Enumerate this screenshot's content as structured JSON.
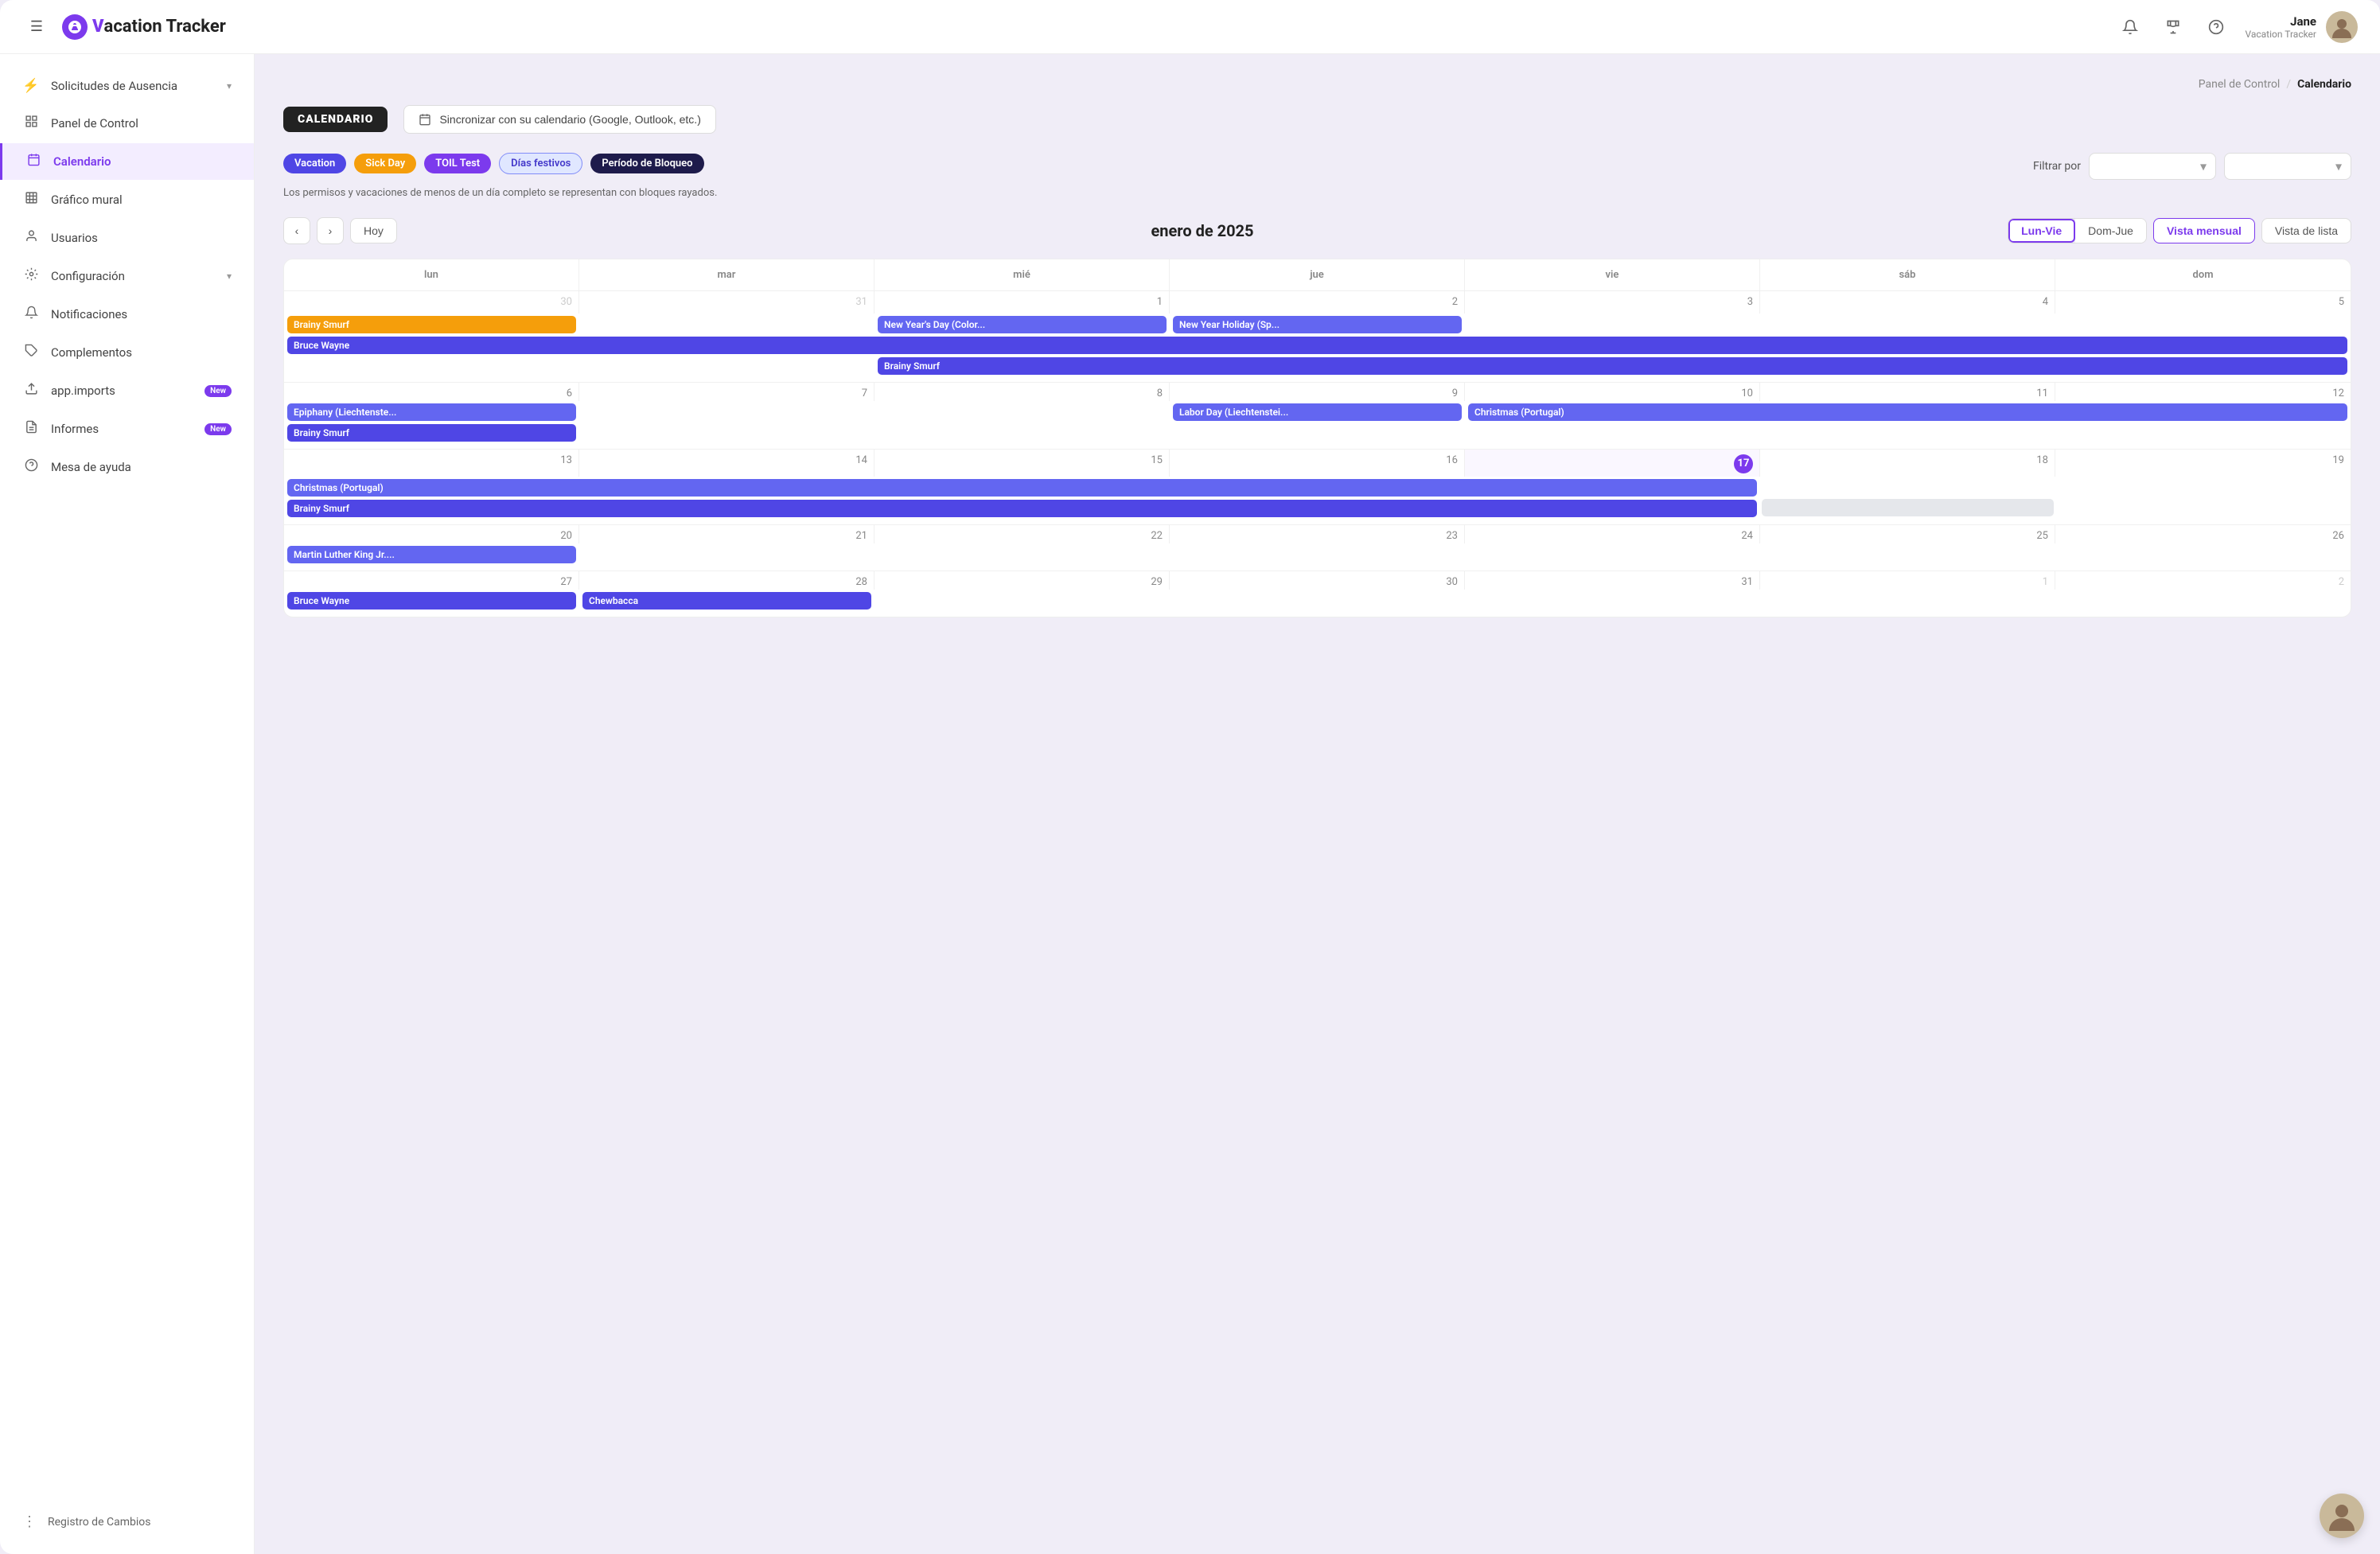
{
  "header": {
    "menu_icon": "☰",
    "logo_icon": "V",
    "logo_text": "acation Tracker",
    "logo_brand": "V",
    "icons": {
      "notification": "🔔",
      "trophy": "🏆",
      "help": "?"
    },
    "user": {
      "name": "Jane",
      "subtitle": "Vacation Tracker",
      "avatar": "👩"
    }
  },
  "sidebar": {
    "items": [
      {
        "id": "solicitudes",
        "label": "Solicitudes de Ausencia",
        "icon": "⚡",
        "has_chevron": true
      },
      {
        "id": "panel",
        "label": "Panel de Control",
        "icon": "◻"
      },
      {
        "id": "calendario",
        "label": "Calendario",
        "icon": "📅",
        "active": true
      },
      {
        "id": "grafico",
        "label": "Gráfico mural",
        "icon": "⊞"
      },
      {
        "id": "usuarios",
        "label": "Usuarios",
        "icon": "👤"
      },
      {
        "id": "configuracion",
        "label": "Configuración",
        "icon": "⚙",
        "has_chevron": true
      },
      {
        "id": "notificaciones",
        "label": "Notificaciones",
        "icon": "🔔"
      },
      {
        "id": "complementos",
        "label": "Complementos",
        "icon": "🧩"
      },
      {
        "id": "app-imports",
        "label": "app.imports",
        "icon": "📤",
        "badge": "New"
      },
      {
        "id": "informes",
        "label": "Informes",
        "icon": "📋",
        "badge": "New"
      },
      {
        "id": "mesa-ayuda",
        "label": "Mesa de ayuda",
        "icon": "?"
      }
    ],
    "footer": {
      "icon": "⋮",
      "label": "Registro de Cambios"
    }
  },
  "content": {
    "breadcrumb": {
      "parent": "Panel de Control",
      "separator": "/",
      "current": "Calendario"
    },
    "page_title": "CALENDARIO",
    "sync_button": "Sincronizar con su calendario (Google, Outlook, etc.)",
    "legend": {
      "chips": [
        {
          "label": "Vacation",
          "class": "legend-vacation"
        },
        {
          "label": "Sick Day",
          "class": "legend-sick"
        },
        {
          "label": "TOIL Test",
          "class": "legend-toil"
        },
        {
          "label": "Días festivos",
          "class": "legend-festivos"
        },
        {
          "label": "Período de Bloqueo",
          "class": "legend-bloqueo"
        }
      ],
      "note": "Los permisos y vacaciones de menos de un día completo se representan con bloques rayados."
    },
    "filter": {
      "label": "Filtrar por",
      "placeholder": ""
    },
    "calendar": {
      "month_title": "enero de 2025",
      "nav": {
        "prev": "‹",
        "next": "›",
        "today": "Hoy"
      },
      "view_days": [
        {
          "label": "Lun-Vie",
          "active": true
        },
        {
          "label": "Dom-Jue",
          "active": false
        }
      ],
      "view_modes": [
        {
          "label": "Vista mensual",
          "active": true
        },
        {
          "label": "Vista de lista",
          "active": false
        }
      ],
      "weekdays": [
        "lun",
        "mar",
        "mié",
        "jue",
        "vie",
        "sáb",
        "dom"
      ],
      "weeks": [
        {
          "days": [
            {
              "num": "30",
              "other": true
            },
            {
              "num": "31",
              "other": true
            },
            {
              "num": "1",
              "other": false
            },
            {
              "num": "2",
              "other": false
            },
            {
              "num": "3",
              "other": false
            },
            {
              "num": "4",
              "other": false
            },
            {
              "num": "5",
              "other": false
            }
          ],
          "events": [
            {
              "label": "Brainy Smurf",
              "type": "sick",
              "col_start": 1,
              "col_span": 1
            },
            {
              "label": "Bruce Wayne",
              "type": "vacation",
              "col_start": 1,
              "col_span": 7
            },
            {
              "label": "New Year's Day (Colom...",
              "type": "holiday",
              "col_start": 3,
              "col_span": 1
            },
            {
              "label": "New Year Holiday (Sp...",
              "type": "holiday",
              "col_start": 4,
              "col_span": 1
            },
            {
              "label": "Brainy Smurf",
              "type": "vacation",
              "col_start": 3,
              "col_span": 5
            }
          ]
        },
        {
          "days": [
            {
              "num": "6",
              "other": false
            },
            {
              "num": "7",
              "other": false
            },
            {
              "num": "8",
              "other": false
            },
            {
              "num": "9",
              "other": false
            },
            {
              "num": "10",
              "other": false
            },
            {
              "num": "11",
              "other": false
            },
            {
              "num": "12",
              "other": false
            }
          ],
          "events": [
            {
              "label": "Epiphany (Liechtenstei...",
              "type": "holiday",
              "col_start": 1,
              "col_span": 1
            },
            {
              "label": "Brainy Smurf",
              "type": "vacation",
              "col_start": 1,
              "col_span": 1
            },
            {
              "label": "Labor Day (Liechtenstei...",
              "type": "holiday",
              "col_start": 4,
              "col_span": 1
            },
            {
              "label": "Christmas (Portugal)",
              "type": "holiday",
              "col_start": 5,
              "col_span": 3
            }
          ]
        },
        {
          "days": [
            {
              "num": "13",
              "other": false
            },
            {
              "num": "14",
              "other": false
            },
            {
              "num": "15",
              "other": false
            },
            {
              "num": "16",
              "other": false
            },
            {
              "num": "17",
              "other": false,
              "today": true
            },
            {
              "num": "18",
              "other": false
            },
            {
              "num": "19",
              "other": false
            }
          ],
          "events": [
            {
              "label": "Christmas (Portugal)",
              "type": "holiday",
              "col_start": 1,
              "col_span": 5
            },
            {
              "label": "Brainy Smurf",
              "type": "vacation",
              "col_start": 1,
              "col_span": 5
            }
          ]
        },
        {
          "days": [
            {
              "num": "20",
              "other": false
            },
            {
              "num": "21",
              "other": false
            },
            {
              "num": "22",
              "other": false
            },
            {
              "num": "23",
              "other": false
            },
            {
              "num": "24",
              "other": false
            },
            {
              "num": "25",
              "other": false
            },
            {
              "num": "26",
              "other": false
            }
          ],
          "events": [
            {
              "label": "Martin Luther King Jr....",
              "type": "holiday",
              "col_start": 1,
              "col_span": 1
            }
          ]
        },
        {
          "days": [
            {
              "num": "27",
              "other": false
            },
            {
              "num": "28",
              "other": false
            },
            {
              "num": "29",
              "other": false
            },
            {
              "num": "30",
              "other": false
            },
            {
              "num": "31",
              "other": false
            },
            {
              "num": "1",
              "other": true
            },
            {
              "num": "2",
              "other": true
            }
          ],
          "events": [
            {
              "label": "Bruce Wayne",
              "type": "vacation",
              "col_start": 1,
              "col_span": 1
            },
            {
              "label": "Chewbacca",
              "type": "vacation",
              "col_start": 2,
              "col_span": 1
            }
          ]
        }
      ]
    }
  },
  "footer_avatar": "👩"
}
